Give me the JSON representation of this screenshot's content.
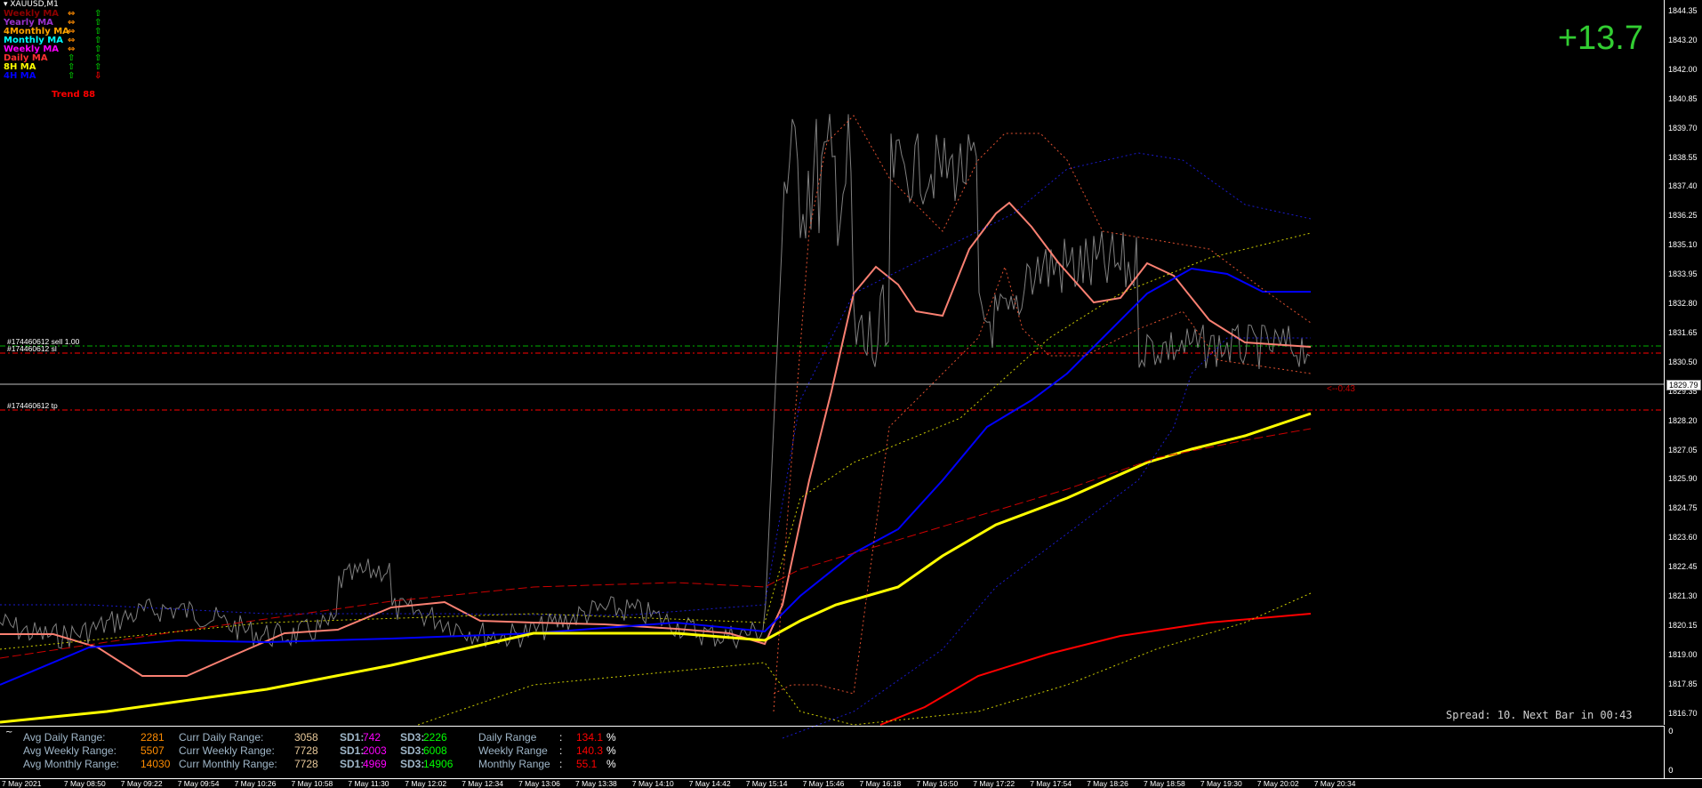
{
  "symbol": "XAUUSD,M1",
  "legend": [
    {
      "name": "Weekly MA",
      "color": "#8b0000",
      "arrow1": "⇔",
      "arrow2": "⇧",
      "arrow2_color": "#00c000"
    },
    {
      "name": "Yearly MA",
      "color": "#9932cc",
      "arrow1": "⇔",
      "arrow2": "⇧",
      "arrow2_color": "#00c000"
    },
    {
      "name": "4Monthly MA",
      "color": "#ffa500",
      "arrow1": "⇔",
      "arrow2": "⇧",
      "arrow2_color": "#00c000"
    },
    {
      "name": "Monthly MA",
      "color": "#00ffff",
      "arrow1": "⇔",
      "arrow2": "⇧",
      "arrow2_color": "#00c000"
    },
    {
      "name": "Weekly MA",
      "color": "#ff00ff",
      "arrow1": "⇔",
      "arrow2": "⇧",
      "arrow2_color": "#00c000"
    },
    {
      "name": "Daily MA",
      "color": "#ff3030",
      "arrow1": "⇧",
      "arrow1_color": "#00c000",
      "arrow2": "⇧",
      "arrow2_color": "#00c000"
    },
    {
      "name": "8H MA",
      "color": "#ffff00",
      "arrow1": "⇧",
      "arrow1_color": "#00c000",
      "arrow2": "⇧",
      "arrow2_color": "#00c000"
    },
    {
      "name": "4H MA",
      "color": "#0000ff",
      "arrow1": "⇧",
      "arrow1_color": "#00c000",
      "arrow2": "⇩",
      "arrow2_color": "#ff0000"
    }
  ],
  "trend_label": "Trend 88",
  "big_value": "+13.7",
  "spread_text": "Spread: 10. Next Bar in 00:43",
  "countdown": "<--0:43",
  "trade_labels": {
    "sell": "#174460612 sell 1.00",
    "sl": "#174460612 sl",
    "tp": "#174460612 tp"
  },
  "current_price": "1829.79",
  "price_axis": [
    "1844.35",
    "1843.20",
    "1842.00",
    "1840.85",
    "1839.70",
    "1838.55",
    "1837.40",
    "1836.25",
    "1835.10",
    "1833.95",
    "1832.80",
    "1831.65",
    "1830.50",
    "1829.35",
    "1828.20",
    "1827.05",
    "1825.90",
    "1824.75",
    "1823.60",
    "1822.45",
    "1821.30",
    "1820.15",
    "1819.00",
    "1817.85",
    "1816.70"
  ],
  "sub_axis": [
    "0",
    "0"
  ],
  "stats": [
    {
      "l1": "Avg Daily Range:",
      "v1": "2281",
      "l2": "Curr Daily Range:",
      "v2": "3058",
      "sd1l": "SD1:",
      "sd1": "742",
      "sd3l": "SD3:",
      "sd3": "2226",
      "l3": "Daily Range",
      "sep": ":",
      "pct": "134.1",
      "pu": "%"
    },
    {
      "l1": "Avg Weekly Range:",
      "v1": "5507",
      "l2": "Curr Weekly Range:",
      "v2": "7728",
      "sd1l": "SD1:",
      "sd1": "2003",
      "sd3l": "SD3:",
      "sd3": "6008",
      "l3": "Weekly Range",
      "sep": ":",
      "pct": "140.3",
      "pu": "%"
    },
    {
      "l1": "Avg Monthly Range:",
      "v1": "14030",
      "l2": "Curr Monthly Range:",
      "v2": "7728",
      "sd1l": "SD1:",
      "sd1": "4969",
      "sd3l": "SD3:",
      "sd3": "14906",
      "l3": "Monthly Range",
      "sep": ":",
      "pct": "55.1",
      "pu": "%"
    }
  ],
  "time_axis": [
    "7 May 2021",
    "7 May 08:50",
    "7 May 09:22",
    "7 May 09:54",
    "7 May 10:26",
    "7 May 10:58",
    "7 May 11:30",
    "7 May 12:02",
    "7 May 12:34",
    "7 May 13:06",
    "7 May 13:38",
    "7 May 14:10",
    "7 May 14:42",
    "7 May 15:14",
    "7 May 15:46",
    "7 May 16:18",
    "7 May 16:50",
    "7 May 17:22",
    "7 May 17:54",
    "7 May 18:26",
    "7 May 18:58",
    "7 May 19:30",
    "7 May 20:02",
    "7 May 20:34"
  ],
  "colors": {
    "price_line": "#808080",
    "daily_ma": "#fa8072",
    "h4_ma": "#0000ff",
    "h8_ma": "#ffff00",
    "red_ma": "#ff0000",
    "sell_line": "#00b000",
    "sl_tp_line": "#ff0000",
    "current_price_line": "#c0c0c0"
  }
}
